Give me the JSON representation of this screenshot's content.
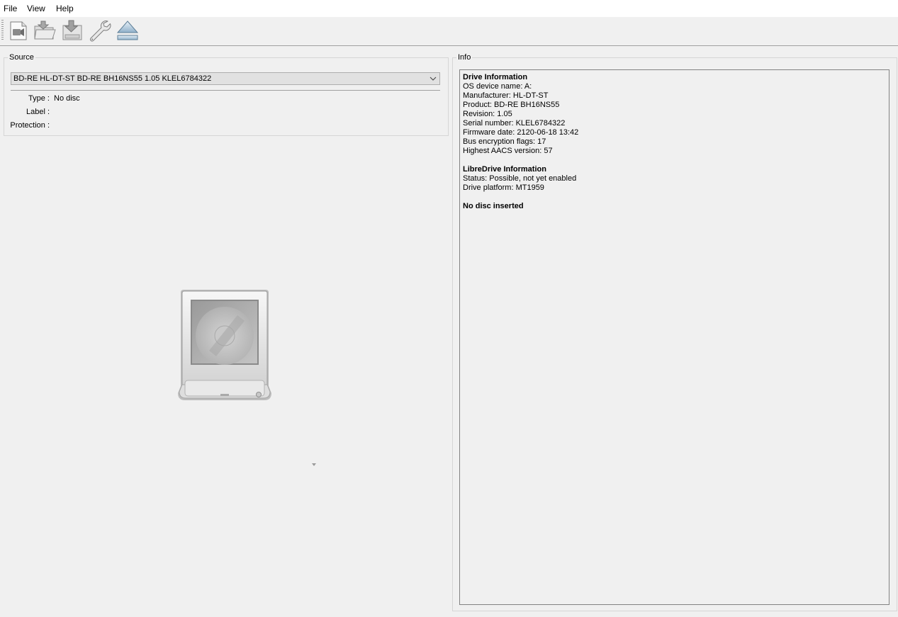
{
  "menu": {
    "file": "File",
    "view": "View",
    "help": "Help"
  },
  "toolbar": {
    "buttons": [
      {
        "icon": "open-files-icon"
      },
      {
        "icon": "open-folder-icon"
      },
      {
        "icon": "save-icon"
      },
      {
        "icon": "preferences-wrench-icon"
      },
      {
        "icon": "eject-icon"
      }
    ]
  },
  "source": {
    "title": "Source",
    "selected_drive": "BD-RE HL-DT-ST BD-RE  BH16NS55 1.05 KLEL6784322",
    "type_label": "Type :",
    "type_value": "No disc",
    "label_label": "Label :",
    "label_value": "",
    "protection_label": "Protection :",
    "protection_value": ""
  },
  "info": {
    "title": "Info",
    "drive_heading": "Drive Information",
    "drive_lines": [
      "OS device name: A:",
      "Manufacturer: HL-DT-ST",
      "Product: BD-RE BH16NS55",
      "Revision: 1.05",
      "Serial number: KLEL6784322",
      "Firmware date: 2120-06-18 13:42",
      "Bus encryption flags: 17",
      "Highest AACS version: 57"
    ],
    "libre_heading": "LibreDrive Information",
    "libre_lines": [
      "Status: Possible, not yet enabled",
      "Drive platform: MT1959"
    ],
    "disc_status": "No disc inserted"
  }
}
